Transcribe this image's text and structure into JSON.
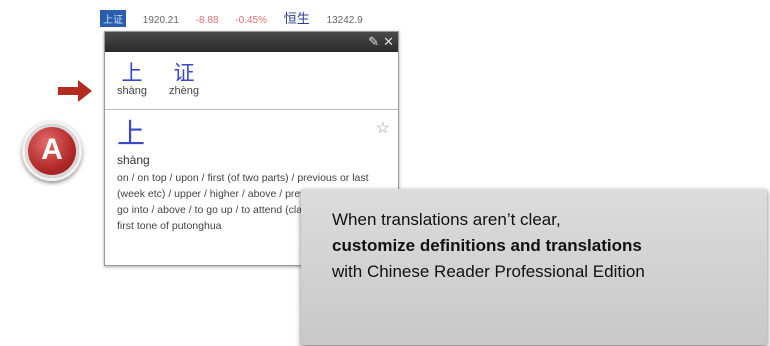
{
  "ticker": {
    "tag": "上证",
    "value": "1920.21",
    "change": "-8.88",
    "percent": "-0.45%",
    "index_name": "恒生",
    "index_value": "13242.9"
  },
  "popup": {
    "words": [
      {
        "hanzi": "上",
        "pinyin": "shàng"
      },
      {
        "hanzi": "证",
        "pinyin": "zhèng"
      }
    ],
    "entry": {
      "hanzi": "上",
      "pinyin": "shàng",
      "definition": "on / on top / upon / first (of two parts) / previous or last (week etc) / upper / higher / above / previous / to climb / to go into / above / to go up / to attend (class or university) / first tone of putonghua"
    }
  },
  "badge": {
    "label": "A"
  },
  "callout": {
    "line1": "When translations aren’t clear,",
    "bold": "customize definitions and translations",
    "line3": "with Chinese Reader Professional Edition"
  },
  "colors": {
    "arrow": "#b52a20",
    "badge": "#b22a2a",
    "hanzi": "#3a49c9",
    "callout_bg": "#d3d3d3"
  }
}
